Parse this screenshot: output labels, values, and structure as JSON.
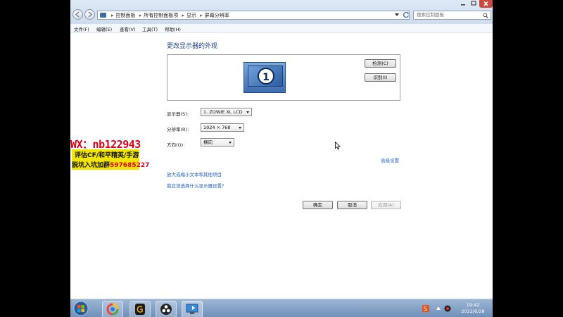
{
  "address_bar": {
    "crumbs": [
      "控制面板",
      "所有控制面板项",
      "显示",
      "屏幕分辨率"
    ]
  },
  "search": {
    "placeholder": "搜索控制面板"
  },
  "menu": {
    "file": "文件(F)",
    "edit": "编辑(E)",
    "view": "查看(V)",
    "tools": "工具(T)",
    "help": "帮助(H)"
  },
  "main": {
    "heading": "更改显示器的外观",
    "monitor_number": "1",
    "detect_button": "检测(C)",
    "identify_button": "识别(I)",
    "display_label": "显示器(S):",
    "display_value": "1. ZOWIE XL LCD",
    "resolution_label": "分辨率(R):",
    "resolution_value": "1024 × 768",
    "orientation_label": "方向(O):",
    "orientation_value": "横向",
    "advanced_link": "高级设置",
    "text_size_link": "放大或缩小文本和其他项目",
    "which_settings_link": "我应该选择什么显示器设置?",
    "ok_button": "确定",
    "cancel_button": "取消",
    "apply_button": "应用(A)"
  },
  "taskbar": {
    "time": "19:42",
    "date": "2022/6/28"
  },
  "promo": {
    "line1": "WX：nb122943",
    "line2": "评估CF/和平精英/手游",
    "line3_prefix": "脱坑入坑加群",
    "line3_number": "597685227"
  },
  "colors": {
    "heading": "#1e3f8a",
    "link": "#1f5fbf",
    "promo_red": "#e0001a",
    "promo_yellow": "#f2e600"
  }
}
